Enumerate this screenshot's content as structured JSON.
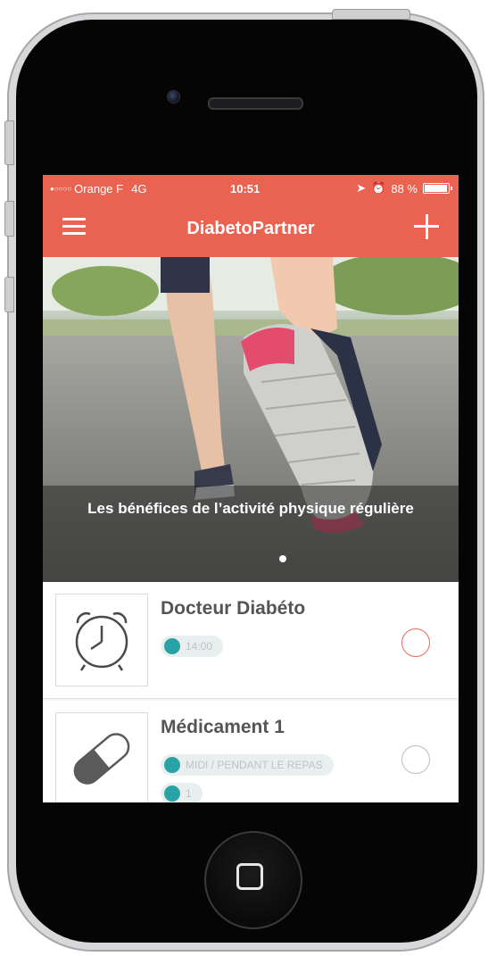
{
  "status_bar": {
    "signal": "●○○○○",
    "carrier": "Orange F",
    "network": "4G",
    "time": "10:51",
    "battery_text": "88 %",
    "battery_level": 0.88
  },
  "nav": {
    "title": "DiabetoPartner",
    "menu_icon": "hamburger-menu-icon",
    "add_icon": "plus-icon",
    "color": "#ea6250"
  },
  "hero": {
    "caption": "Les bénéfices de l’activité physique régulière",
    "active_slide": 1
  },
  "cards": [
    {
      "title": "Docteur Diabéto",
      "icon": "alarm-clock-icon",
      "time": "14:00",
      "check_color": "#e8685a"
    },
    {
      "title": "Médicament 1",
      "icon": "pill-icon",
      "schedule": "MIDI / PENDANT LE REPAS",
      "dose": "1",
      "check_color": "#bdbdbd"
    }
  ],
  "colors": {
    "accent": "#ea6250",
    "teal": "#29a3a6"
  }
}
